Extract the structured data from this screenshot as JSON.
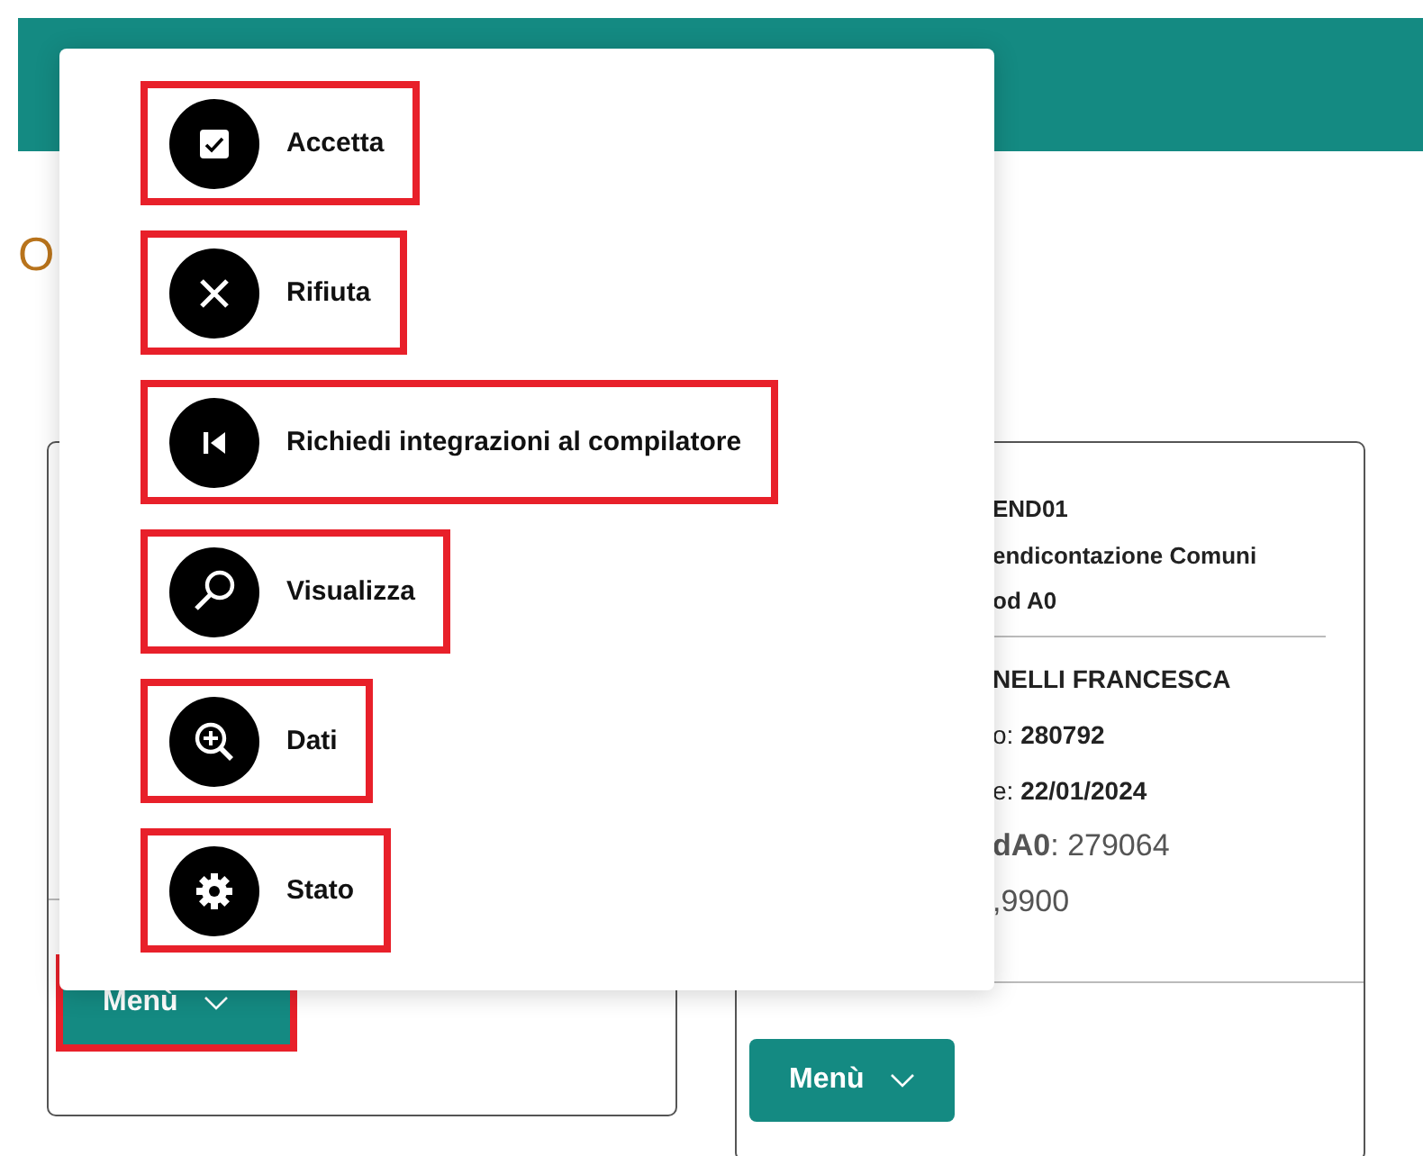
{
  "page_heading": "O",
  "cards": [
    {
      "menu_button": {
        "label": "Menù",
        "highlighted": true
      }
    },
    {
      "lines": [
        {
          "kind": "title",
          "text": "END01"
        },
        {
          "kind": "title",
          "text": "endicontazione Comuni"
        },
        {
          "kind": "title",
          "text": "od A0"
        },
        {
          "kind": "divider"
        },
        {
          "kind": "name",
          "text": "NELLI FRANCESCA"
        },
        {
          "kind": "field",
          "text": "o: **280792**"
        },
        {
          "kind": "field",
          "text": "e: **22/01/2024**"
        },
        {
          "kind": "value",
          "text": "**dA0**: 279064"
        },
        {
          "kind": "value",
          "text": ",9900"
        }
      ],
      "menu_button": {
        "label": "Menù",
        "highlighted": false
      }
    }
  ],
  "dropdown_menu": {
    "items": [
      {
        "label": "Accetta",
        "highlighted": true
      },
      {
        "label": "Rifiuta",
        "highlighted": true
      },
      {
        "label": "Richiedi integrazioni al compilatore",
        "highlighted": true
      },
      {
        "label": "Visualizza",
        "highlighted": true
      },
      {
        "label": "Dati",
        "highlighted": true
      },
      {
        "label": "Stato",
        "highlighted": true
      }
    ]
  }
}
